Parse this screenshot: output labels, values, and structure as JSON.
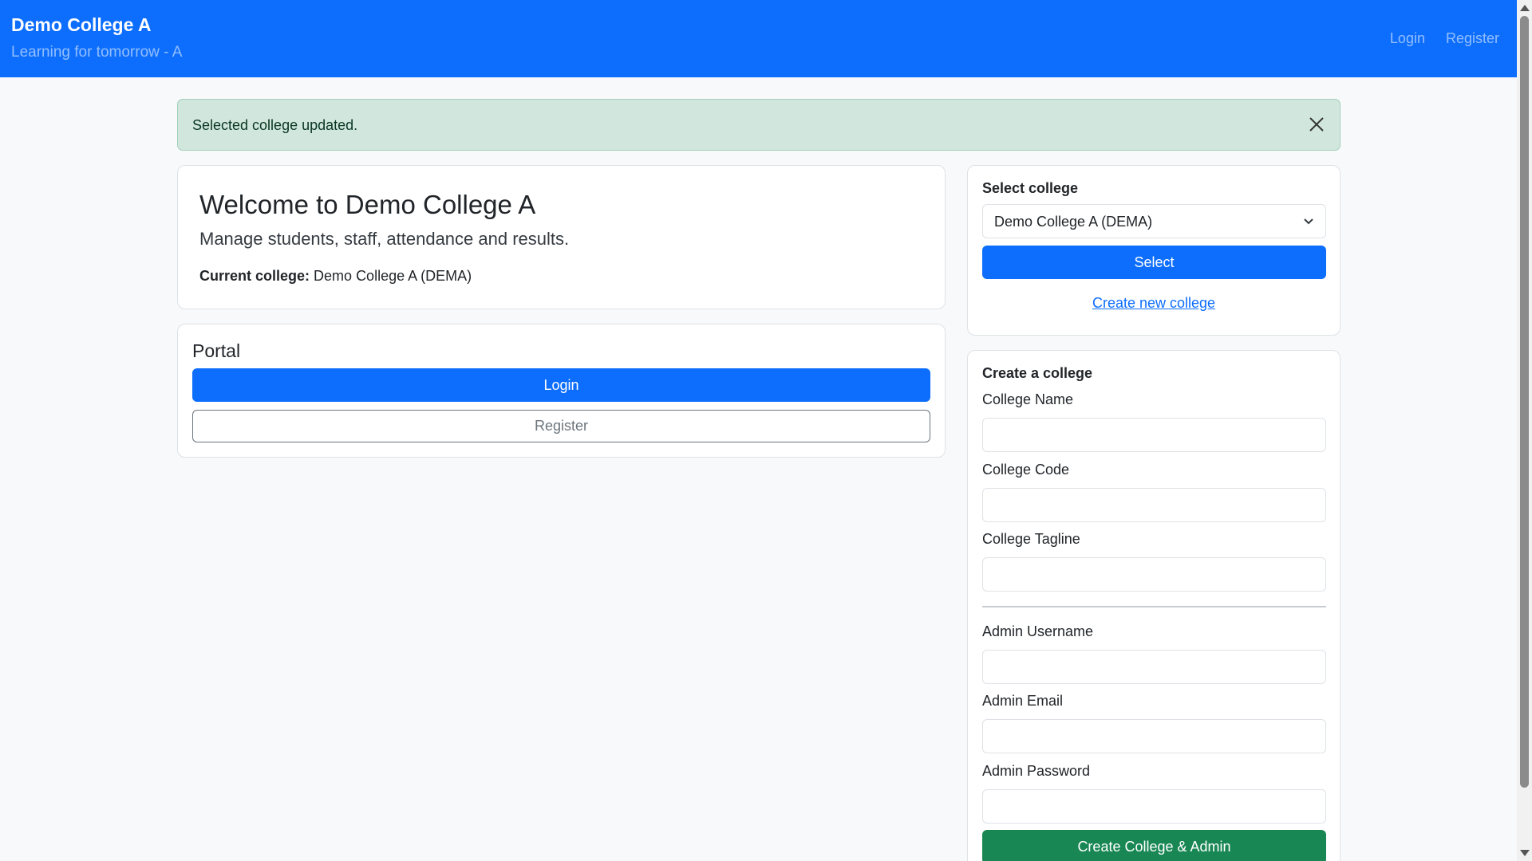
{
  "navbar": {
    "brand": "Demo College A",
    "tagline": "Learning for tomorrow - A",
    "links": [
      "Login",
      "Register"
    ]
  },
  "alert": {
    "message": "Selected college updated."
  },
  "welcome": {
    "title": "Welcome to Demo College A",
    "lead": "Manage students, staff, attendance and results.",
    "current_label": "Current college:",
    "current_value": "Demo College A (DEMA)"
  },
  "portal": {
    "title": "Portal",
    "login_label": "Login",
    "register_label": "Register"
  },
  "select_college": {
    "heading": "Select college",
    "selected_value": "Demo College A (DEMA)",
    "button_label": "Select",
    "create_link": "Create new college"
  },
  "create_college": {
    "heading": "Create a college",
    "fields": {
      "college_name": "College Name",
      "college_code": "College Code",
      "college_tagline": "College Tagline",
      "admin_username": "Admin Username",
      "admin_email": "Admin Email",
      "admin_password": "Admin Password"
    },
    "submit_label": "Create College & Admin"
  },
  "colors": {
    "primary": "#0d6efd",
    "success": "#198754",
    "alert_bg": "#d1e7dd"
  }
}
